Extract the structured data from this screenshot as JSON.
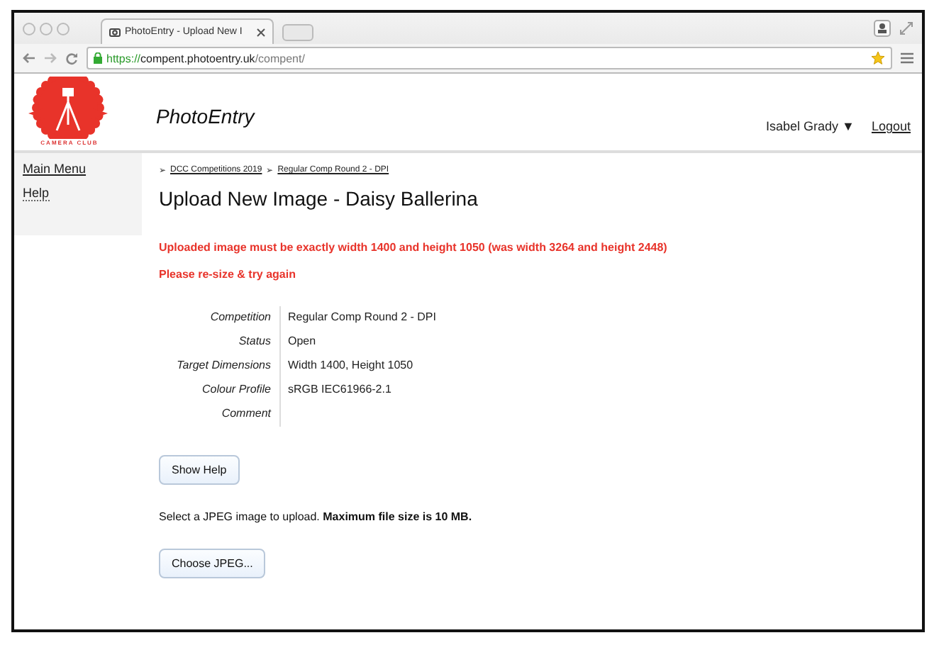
{
  "browser": {
    "tab_title": "PhotoEntry - Upload New I",
    "url_scheme": "https://",
    "url_host": "compent.photoentry.uk",
    "url_path": "/compent/"
  },
  "header": {
    "logo_caption": "CAMERA CLUB",
    "site_title": "PhotoEntry",
    "user": "Isabel Grady ▼",
    "logout": "Logout"
  },
  "sidebar": {
    "items": [
      {
        "label": "Main Menu",
        "selected": true
      },
      {
        "label": "Help",
        "selected": false
      }
    ]
  },
  "breadcrumbs": [
    {
      "sep": "➢",
      "label": "DCC Competitions 2019"
    },
    {
      "sep": "➢",
      "label": "Regular Comp Round 2 - DPI"
    }
  ],
  "heading": "Upload New Image - Daisy Ballerina",
  "errors": [
    "Uploaded image must be exactly width 1400 and height 1050 (was width 3264 and height 2448)",
    "Please re-size & try again"
  ],
  "details": [
    {
      "label": "Competition",
      "value": "Regular Comp Round 2 - DPI"
    },
    {
      "label": "Status",
      "value": "Open"
    },
    {
      "label": "Target Dimensions",
      "value": "Width 1400, Height 1050"
    },
    {
      "label": "Colour Profile",
      "value": "sRGB IEC61966-2.1"
    },
    {
      "label": "Comment"
    }
  ],
  "show_help_button": "Show Help",
  "instruction": "Select a JPEG image to upload. **Maximum file size is 10 MB.**",
  "choose_button": "Choose JPEG..."
}
